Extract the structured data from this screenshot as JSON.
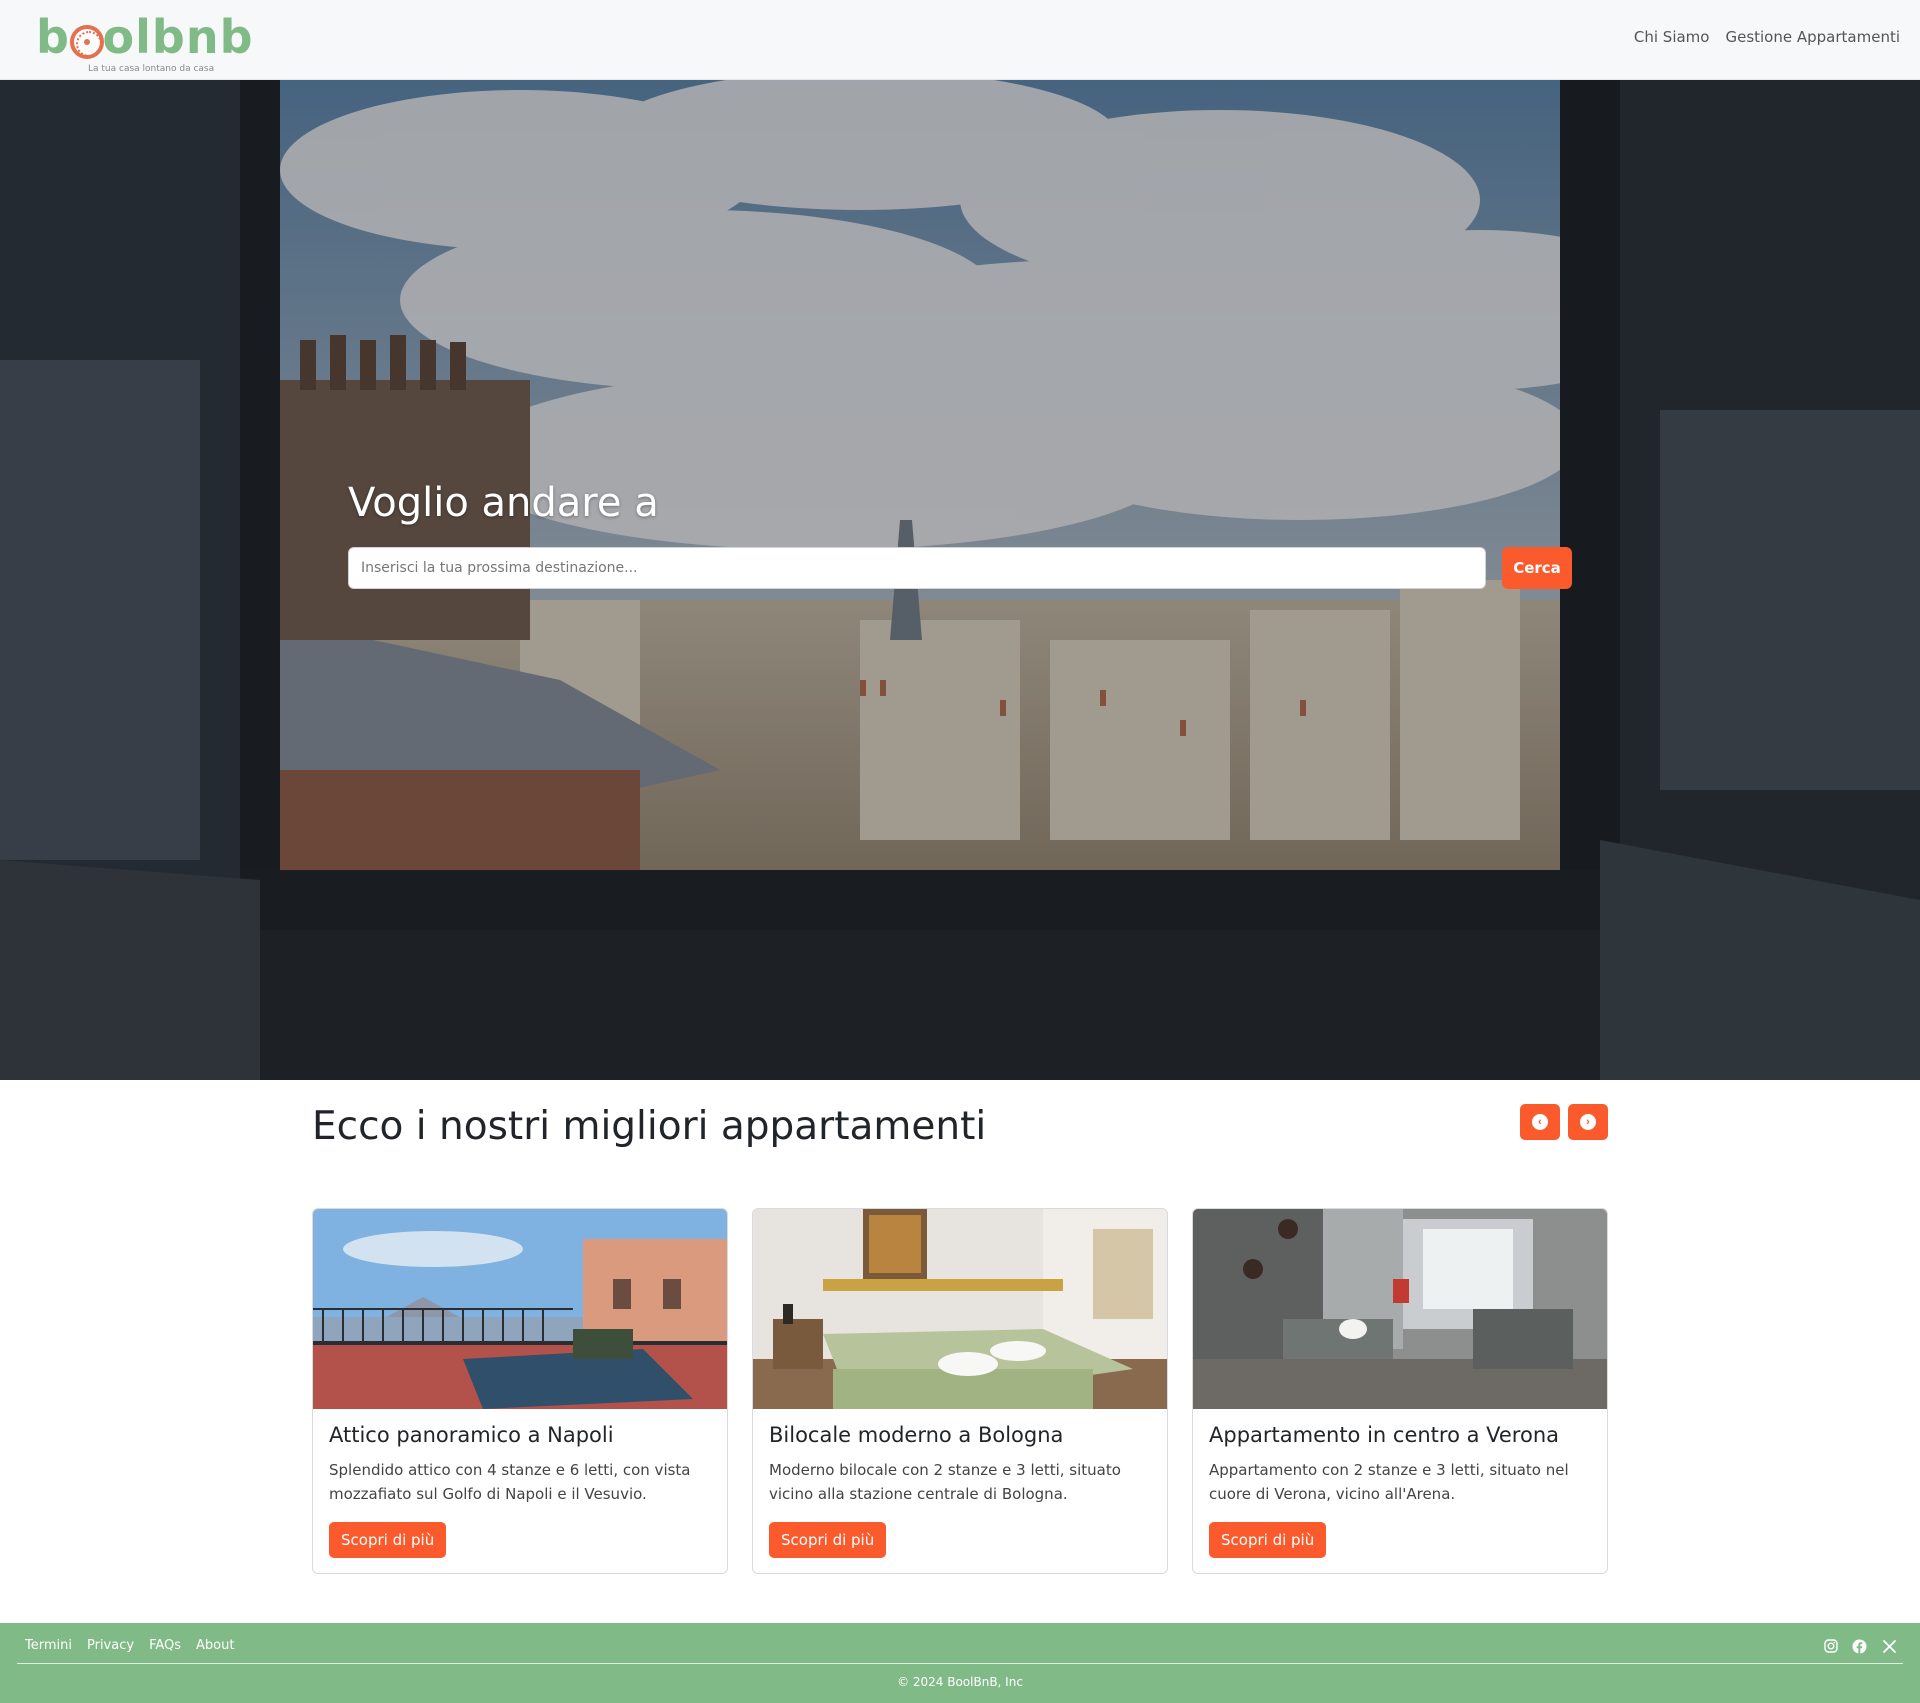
{
  "brand": {
    "name": "boolbnb",
    "tagline": "La tua casa lontano da casa",
    "accent_color": "#fb5b2c",
    "green_color": "#80bb87"
  },
  "nav": {
    "links": [
      {
        "label": "Chi Siamo"
      },
      {
        "label": "Gestione Appartamenti"
      }
    ]
  },
  "hero": {
    "title": "Voglio andare a",
    "search_placeholder": "Inserisci la tua prossima destinazione...",
    "search_value": "",
    "search_button": "Cerca"
  },
  "featured": {
    "title": "Ecco i nostri migliori appartamenti",
    "prev_icon": "chevron-left-icon",
    "next_icon": "chevron-right-icon",
    "cards": [
      {
        "title": "Attico panoramico a Napoli",
        "description": "Splendido attico con 4 stanze e 6 letti, con vista mozzafiato sul Golfo di Napoli e il Vesuvio.",
        "button": "Scopri di più"
      },
      {
        "title": "Bilocale moderno a Bologna",
        "description": "Moderno bilocale con 2 stanze e 3 letti, situato vicino alla stazione centrale di Bologna.",
        "button": "Scopri di più"
      },
      {
        "title": "Appartamento in centro a Verona",
        "description": "Appartamento con 2 stanze e 3 letti, situato nel cuore di Verona, vicino all'Arena.",
        "button": "Scopri di più"
      }
    ]
  },
  "footer": {
    "links": [
      {
        "label": "Termini"
      },
      {
        "label": "Privacy"
      },
      {
        "label": "FAQs"
      },
      {
        "label": "About"
      }
    ],
    "socials": [
      "instagram-icon",
      "facebook-icon",
      "x-icon"
    ],
    "copyright": "© 2024 BoolBnB, Inc"
  }
}
